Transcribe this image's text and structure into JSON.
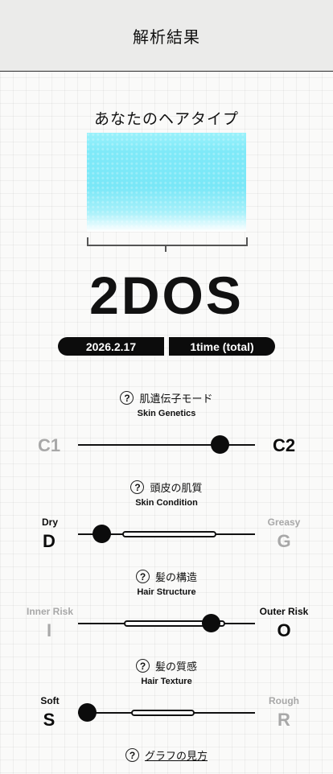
{
  "header": {
    "title": "解析結果"
  },
  "result": {
    "type_label": "あなたのヘアタイプ",
    "code": "2DOS",
    "date": "2026.2.17",
    "count": "1time (total)"
  },
  "axes": [
    {
      "title_ja": "肌遺伝子モード",
      "title_en": "Skin Genetics",
      "left": {
        "letter": "C1",
        "label": ""
      },
      "right": {
        "letter": "C2",
        "label": ""
      },
      "position": 0.84,
      "active_side": "right",
      "range": null
    },
    {
      "title_ja": "頭皮の肌質",
      "title_en": "Skin Condition",
      "left": {
        "letter": "D",
        "label": "Dry"
      },
      "right": {
        "letter": "G",
        "label": "Greasy"
      },
      "position": 0.09,
      "active_side": "left",
      "range": [
        0.25,
        0.78
      ]
    },
    {
      "title_ja": "髪の構造",
      "title_en": "Hair Structure",
      "left": {
        "letter": "I",
        "label": "Inner Risk"
      },
      "right": {
        "letter": "O",
        "label": "Outer Risk"
      },
      "position": 0.78,
      "active_side": "right",
      "range": [
        0.26,
        0.83
      ]
    },
    {
      "title_ja": "髪の質感",
      "title_en": "Hair Texture",
      "left": {
        "letter": "S",
        "label": "Soft"
      },
      "right": {
        "letter": "R",
        "label": "Rough"
      },
      "position": 0.0,
      "active_side": "left",
      "range": [
        0.3,
        0.66
      ]
    }
  ],
  "guide": {
    "label": "グラフの見方"
  },
  "colors": {
    "active": "#0c0c0c",
    "muted": "#a8a8a8",
    "accent_cyan": "#7ee9f8"
  },
  "icons": {
    "help": "question-circle-icon"
  }
}
